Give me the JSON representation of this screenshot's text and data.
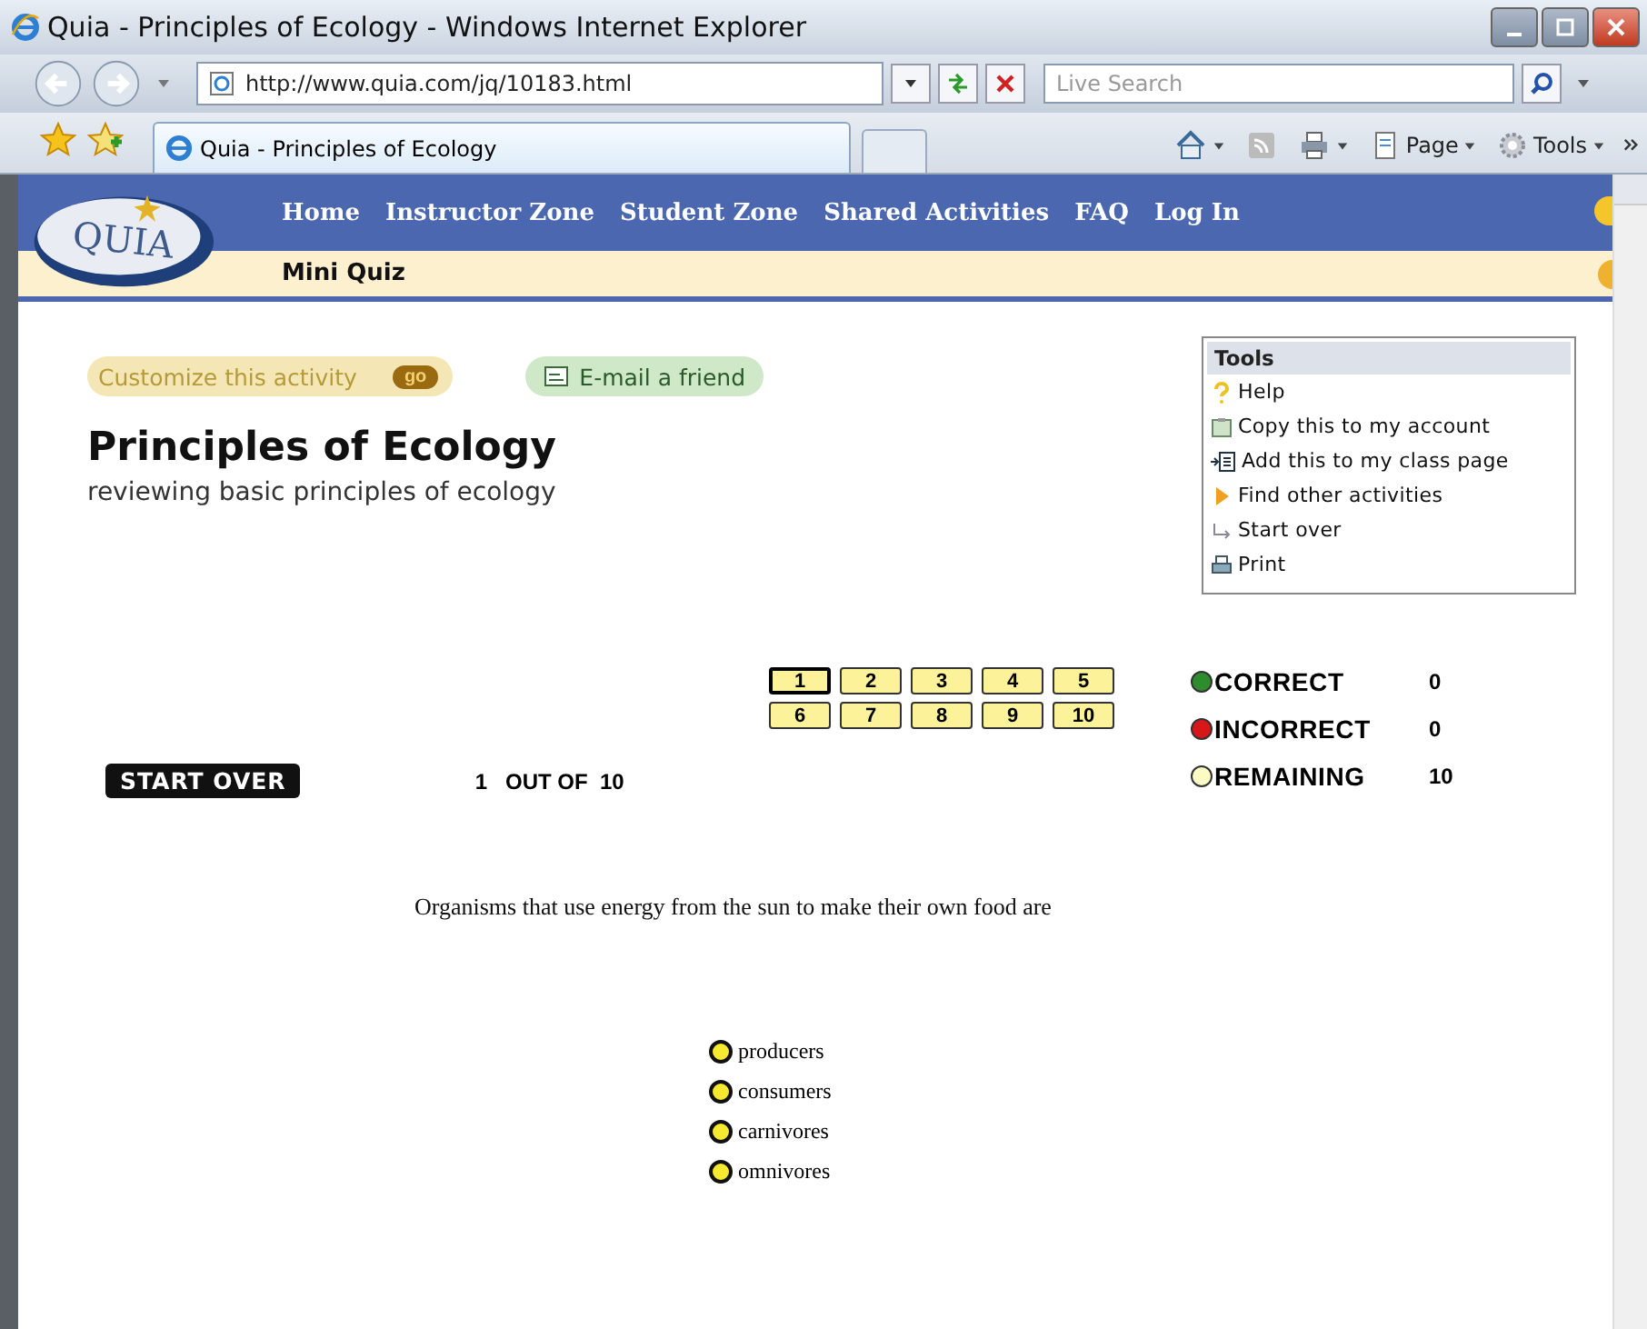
{
  "window": {
    "title": "Quia - Principles of Ecology - Windows Internet Explorer"
  },
  "address_bar": {
    "url": "http://www.quia.com/jq/10183.html"
  },
  "search": {
    "placeholder": "Live Search"
  },
  "tab": {
    "label": "Quia - Principles of Ecology"
  },
  "command_bar": [
    {
      "kind": "home"
    },
    {
      "kind": "feeds"
    },
    {
      "kind": "print"
    },
    {
      "kind": "page",
      "label": "Page"
    },
    {
      "kind": "tools",
      "label": "Tools"
    }
  ],
  "site_nav": {
    "logo": "QUIA",
    "items": [
      "Home",
      "Instructor Zone",
      "Student Zone",
      "Shared Activities",
      "FAQ",
      "Log In"
    ],
    "subtitle": "Mini Quiz"
  },
  "customize": {
    "label": "Customize this activity",
    "button": "go"
  },
  "email": {
    "label": "E-mail a friend"
  },
  "activity": {
    "title": "Principles of Ecology",
    "description": "reviewing basic principles of ecology"
  },
  "tools_panel": {
    "title": "Tools",
    "items": [
      {
        "kind": "help",
        "label": "Help"
      },
      {
        "kind": "copy",
        "label": "Copy this to my account"
      },
      {
        "kind": "add",
        "label": "Add this to my class page"
      },
      {
        "kind": "find",
        "label": "Find other activities"
      },
      {
        "kind": "restart",
        "label": "Start over"
      },
      {
        "kind": "print",
        "label": "Print"
      }
    ]
  },
  "question_numbers": [
    {
      "label": "1",
      "selected": true
    },
    {
      "label": "2",
      "selected": false
    },
    {
      "label": "3",
      "selected": false
    },
    {
      "label": "4",
      "selected": false
    },
    {
      "label": "5",
      "selected": false
    },
    {
      "label": "6",
      "selected": false
    },
    {
      "label": "7",
      "selected": false
    },
    {
      "label": "8",
      "selected": false
    },
    {
      "label": "9",
      "selected": false
    },
    {
      "label": "10",
      "selected": false
    }
  ],
  "score": [
    {
      "label": "CORRECT",
      "value": "0",
      "color": "#2e8b2e"
    },
    {
      "label": "INCORRECT",
      "value": "0",
      "color": "#d81818"
    },
    {
      "label": "REMAINING",
      "value": "10",
      "color": "#fdfbc4"
    }
  ],
  "start_over": "START OVER",
  "progress": {
    "current": "1",
    "separator": "OUT OF",
    "total": "10"
  },
  "question": "Organisms that use energy from the sun to make their own food are",
  "options": [
    {
      "label": "producers",
      "selected": false
    },
    {
      "label": "consumers",
      "selected": false
    },
    {
      "label": "carnivores",
      "selected": false
    },
    {
      "label": "omnivores",
      "selected": false
    }
  ]
}
